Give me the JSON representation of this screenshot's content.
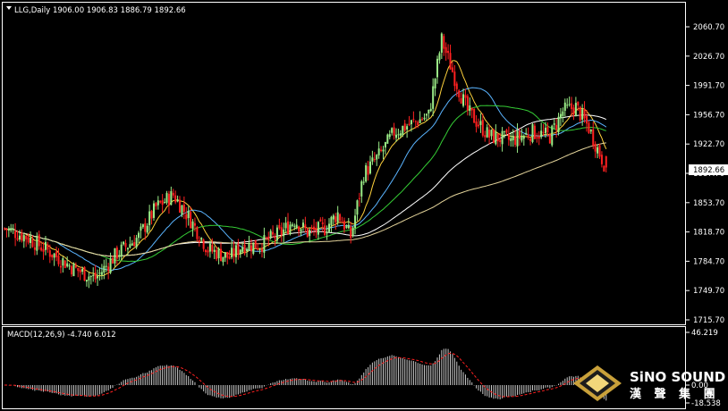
{
  "chart_data": {
    "type": "candlestick",
    "header": "LLG,Daily  1906.00 1906.83 1886.79 1892.66",
    "symbol": "LLG",
    "timeframe": "Daily",
    "ohlc": {
      "open": 1906.0,
      "high": 1906.83,
      "low": 1886.79,
      "close": 1892.66
    },
    "current_price_label": "1892.66",
    "price_ticks": [
      "2060.70",
      "2026.70",
      "1991.70",
      "1956.70",
      "1922.70",
      "1887.70",
      "1853.70",
      "1818.70",
      "1784.70",
      "1749.70",
      "1715.70"
    ],
    "price_ylim": [
      1715.7,
      2074
    ],
    "bull_color": "#9bec87",
    "bear_color": "#ff2020",
    "ma_colors": [
      "#ffd23c",
      "#5ab4ff",
      "#35cc35",
      "#ffffff",
      "#e3d39a"
    ],
    "macd": {
      "label": "MACD(12,26,9) -4.740 6.012",
      "params": "12,26,9",
      "macd_value": -4.74,
      "signal_value": 6.012,
      "ticks": [
        "46.219",
        "0.00",
        "-18.538"
      ],
      "histogram_color": "#c8c8c8",
      "signal_color": "#ff2020"
    }
  },
  "watermark": {
    "english": "SiNO SOUND",
    "chinese": "漢 聲 集 團"
  }
}
